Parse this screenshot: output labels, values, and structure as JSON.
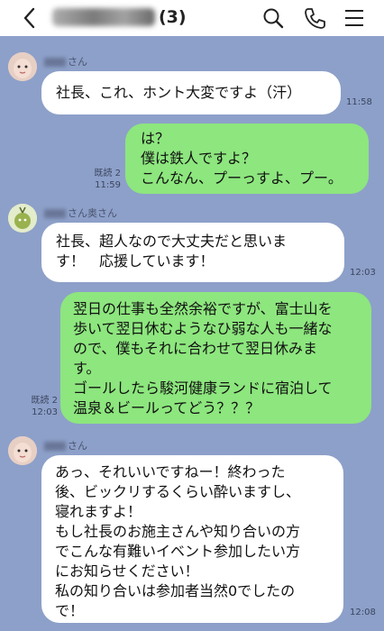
{
  "header": {
    "title_count": "(3)"
  },
  "messages": [
    {
      "sender_suffix": "さん",
      "lines": [
        "社長、これ、ホント大変ですよ（汗）"
      ],
      "time": "11:58"
    },
    {
      "read": "既読 2",
      "time": "11:59",
      "lines": [
        "は？",
        "僕は鉄人ですよ？",
        "こんなん、プーっすよ、プー。"
      ]
    },
    {
      "sender_suffix": "さん奥さん",
      "lines": [
        "社長、超人なので大丈夫だと思いま",
        "す！　応援しています！"
      ],
      "time": "12:03"
    },
    {
      "read": "既読 2",
      "time": "12:03",
      "lines": [
        "翌日の仕事も全然余裕ですが、富士山を",
        "歩いて翌日休むようなひ弱な人も一緒な",
        "ので、僕もそれに合わせて翌日休みま",
        "す。",
        "ゴールしたら駿河健康ランドに宿泊して",
        "温泉＆ビールってどう？？？"
      ]
    },
    {
      "sender_suffix": "さん",
      "lines": [
        "あっ、それいいですねー！終わった",
        "後、ビックリするくらい酔いますし、",
        "寝れますよ！",
        "もし社長のお施主さんや知り合いの方",
        "でこんな有難いイベント参加したい方",
        "にお知らせください！",
        "私の知り合いは参加者当然0でしたの",
        "で！"
      ],
      "time": "12:08"
    }
  ],
  "icons": [
    "back-icon",
    "search-icon",
    "phone-icon",
    "menu-icon"
  ]
}
